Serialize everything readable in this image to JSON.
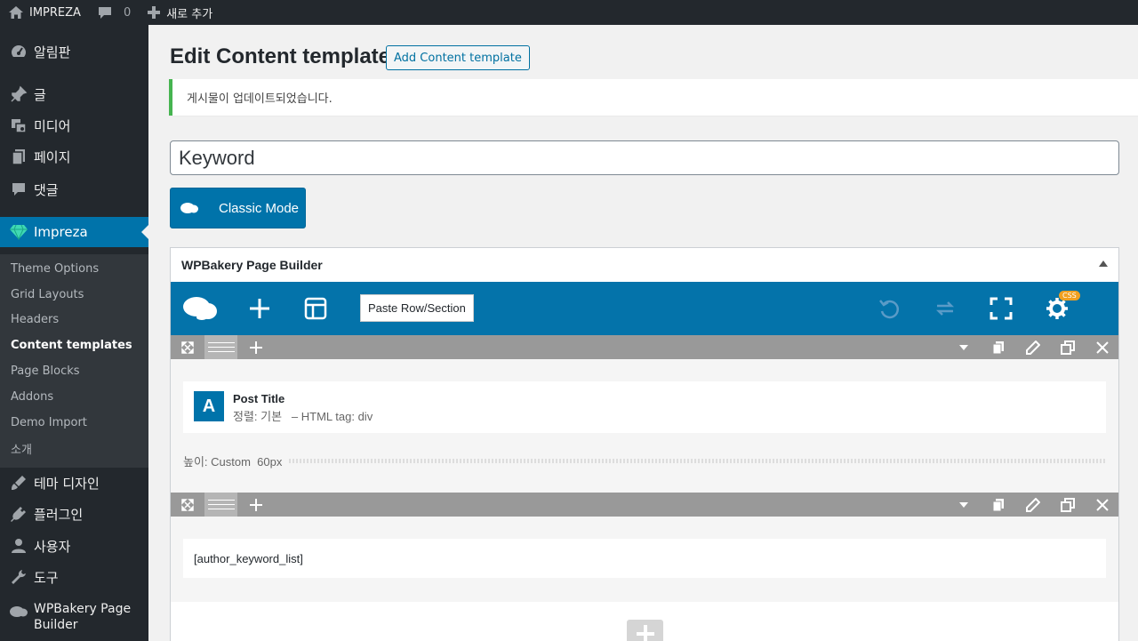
{
  "adminbar": {
    "site_name": "IMPREZA",
    "comments_count": "0",
    "new_label": "새로 추가",
    "icons": [
      "home-icon",
      "comment-icon",
      "plus-icon"
    ]
  },
  "sidebar": {
    "items": [
      {
        "label": "알림판",
        "icon": "dashboard-icon"
      },
      {
        "label": "글",
        "icon": "pin-icon"
      },
      {
        "label": "미디어",
        "icon": "media-icon"
      },
      {
        "label": "페이지",
        "icon": "page-icon"
      },
      {
        "label": "댓글",
        "icon": "comment-icon"
      },
      {
        "label": "Impreza",
        "icon": "diamond-icon",
        "active": true
      },
      {
        "label": "테마 디자인",
        "icon": "brush-icon"
      },
      {
        "label": "플러그인",
        "icon": "plugin-icon"
      },
      {
        "label": "사용자",
        "icon": "user-icon"
      },
      {
        "label": "도구",
        "icon": "wrench-icon"
      },
      {
        "label": "WPBakery Page Builder",
        "icon": "wpbakery-icon"
      }
    ],
    "submenu": [
      "Theme Options",
      "Grid Layouts",
      "Headers",
      "Content templates",
      "Page Blocks",
      "Addons",
      "Demo Import",
      "소개"
    ],
    "submenu_current": "Content templates"
  },
  "main": {
    "page_title": "Edit Content template",
    "add_button": "Add Content template",
    "notice": "게시물이 업데이트되었습니다.",
    "title_value": "Keyword",
    "classic_mode": "Classic Mode"
  },
  "builder": {
    "box_title": "WPBakery Page Builder",
    "paste_label": "Paste Row/Section",
    "css_badge": "CSS",
    "row1": {
      "element_icon_letter": "A",
      "element_title": "Post Title",
      "element_param_prefix": "정렬: 기본",
      "element_param_suffix": "– HTML tag: div",
      "spacer_label": "높이: Custom  60px"
    },
    "row2": {
      "text_content": "[author_keyword_list]"
    }
  },
  "colors": {
    "admin_dark": "#23282d",
    "submenu_bg": "#32373c",
    "accent_blue": "#0073aa",
    "notice_green": "#46b450",
    "row_bar_gray": "#999999",
    "css_badge_orange": "#f0a020"
  }
}
